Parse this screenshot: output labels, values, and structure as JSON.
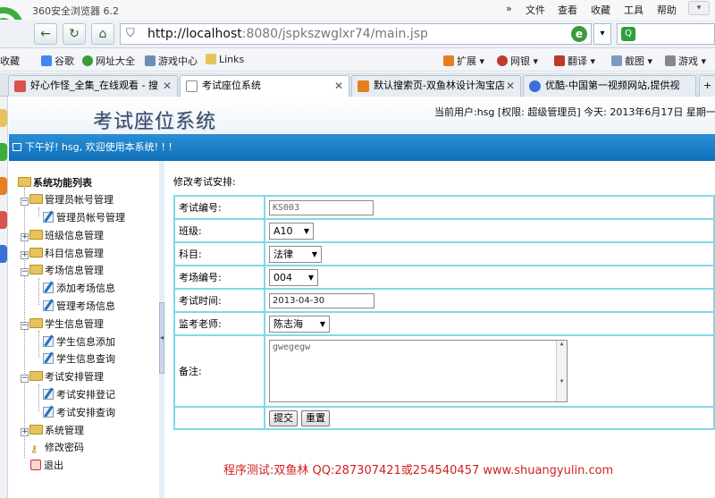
{
  "browser": {
    "title": "360安全浏览器 6.2",
    "menu": [
      "文件",
      "查看",
      "收藏",
      "工具",
      "帮助"
    ],
    "url_host": "http://localhost",
    "url_rest": ":8080/jspkszwglxr74/main.jsp",
    "bookmarks": [
      "收藏",
      "谷歌",
      "网址大全",
      "游戏中心",
      "Links",
      "扩展",
      "网银",
      "翻译",
      "截图",
      "游戏"
    ],
    "tabs": [
      {
        "label": "好心作怪_全集_在线观看 - 搜",
        "color": "#d9534f"
      },
      {
        "label": "考试座位系统",
        "color": "#ffffff"
      },
      {
        "label": "默认搜索页-双鱼林设计淘宝店",
        "color": "#e67e22"
      },
      {
        "label": "优酷-中国第一视频网站,提供视",
        "color": "#3a6fd8"
      }
    ]
  },
  "header": {
    "title": "考试座位系统",
    "userinfo": "当前用户:hsg [权限: 超级管理员] 今天:  2013年6月17日 星期一",
    "welcome": "下午好! hsg, 欢迎使用本系统! ! !"
  },
  "tree": {
    "root": "系统功能列表",
    "items": [
      "管理员帐号管理",
      "管理员帐号管理",
      "班级信息管理",
      "科目信息管理",
      "考场信息管理",
      "添加考场信息",
      "管理考场信息",
      "学生信息管理",
      "学生信息添加",
      "学生信息查询",
      "考试安排管理",
      "考试安排登记",
      "考试安排查询",
      "系统管理",
      "修改密码",
      "退出"
    ]
  },
  "form": {
    "title": "修改考试安排:",
    "labels": {
      "exam_no": "考试编号:",
      "class": "班级:",
      "subject": "科目:",
      "room": "考场编号:",
      "time": "考试时间:",
      "teacher": "监考老师:",
      "remark": "备注:"
    },
    "values": {
      "exam_no": "KS003",
      "class": "A10",
      "subject": "法律",
      "room": "004",
      "time": "2013-04-30",
      "teacher": "陈志海",
      "remark": "gwegegw"
    },
    "submit": "提交",
    "reset": "重置"
  },
  "footer": "程序测试:双鱼林 QQ:287307421或254540457 www.shuangyulin.com"
}
